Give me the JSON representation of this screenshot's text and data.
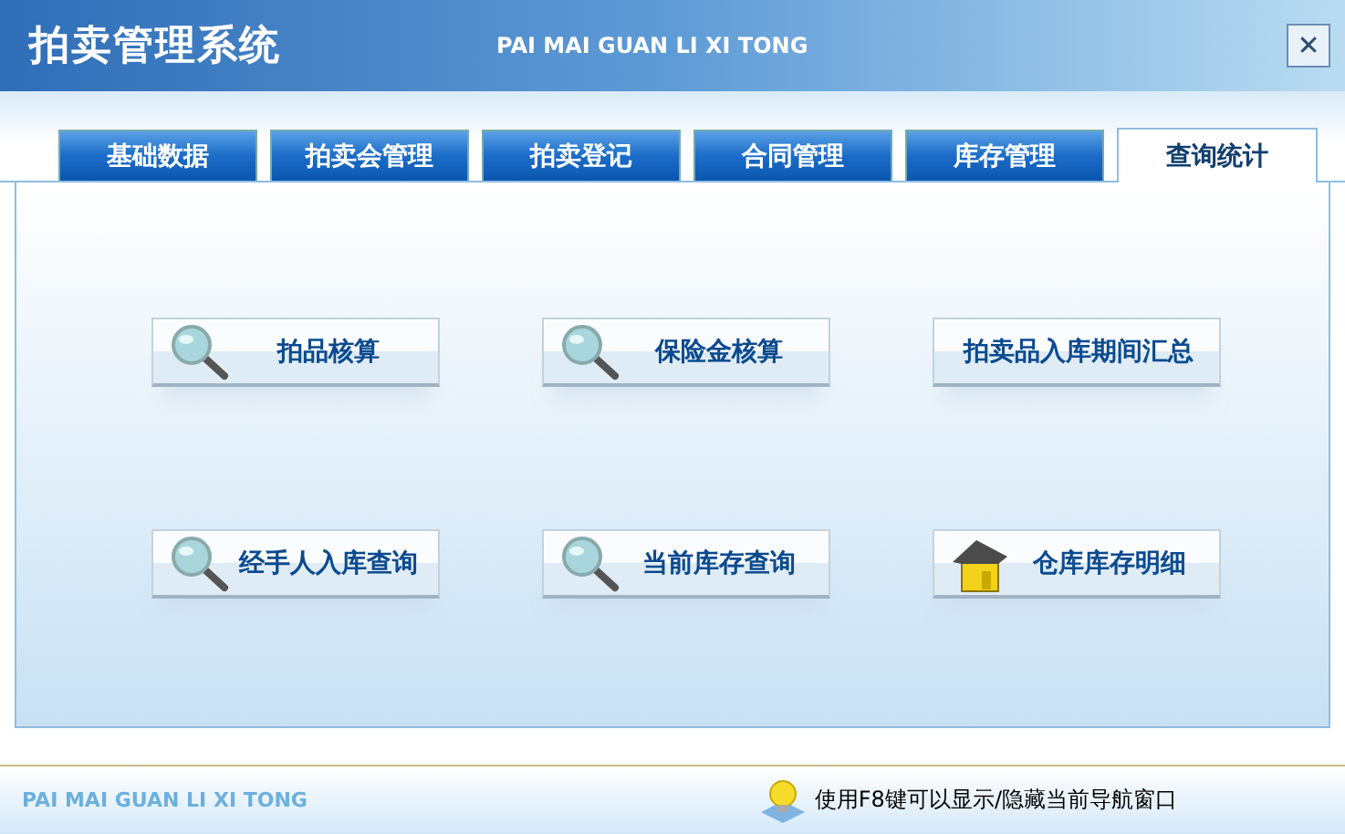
{
  "window": {
    "title": "拍卖管理系统",
    "subtitle": "PAI MAI GUAN LI XI TONG",
    "close": "✕"
  },
  "tabs": [
    {
      "label": "基础数据",
      "selected": false
    },
    {
      "label": "拍卖会管理",
      "selected": false
    },
    {
      "label": "拍卖登记",
      "selected": false
    },
    {
      "label": "合同管理",
      "selected": false
    },
    {
      "label": "库存管理",
      "selected": false
    },
    {
      "label": "查询统计",
      "selected": true
    }
  ],
  "buttons": [
    {
      "label": "拍品核算",
      "kind": "search"
    },
    {
      "label": "保险金核算",
      "kind": "search"
    },
    {
      "label": "拍卖品入库期间汇总",
      "kind": "none"
    },
    {
      "label": "经手人入库查询",
      "kind": "search"
    },
    {
      "label": "当前库存查询",
      "kind": "search"
    },
    {
      "label": "仓库库存明细",
      "kind": "house"
    }
  ],
  "status_bar": {
    "brand": "PAI MAI GUAN LI XI TONG",
    "hint": "使用F8键可以显示/隐藏当前导航窗口"
  }
}
